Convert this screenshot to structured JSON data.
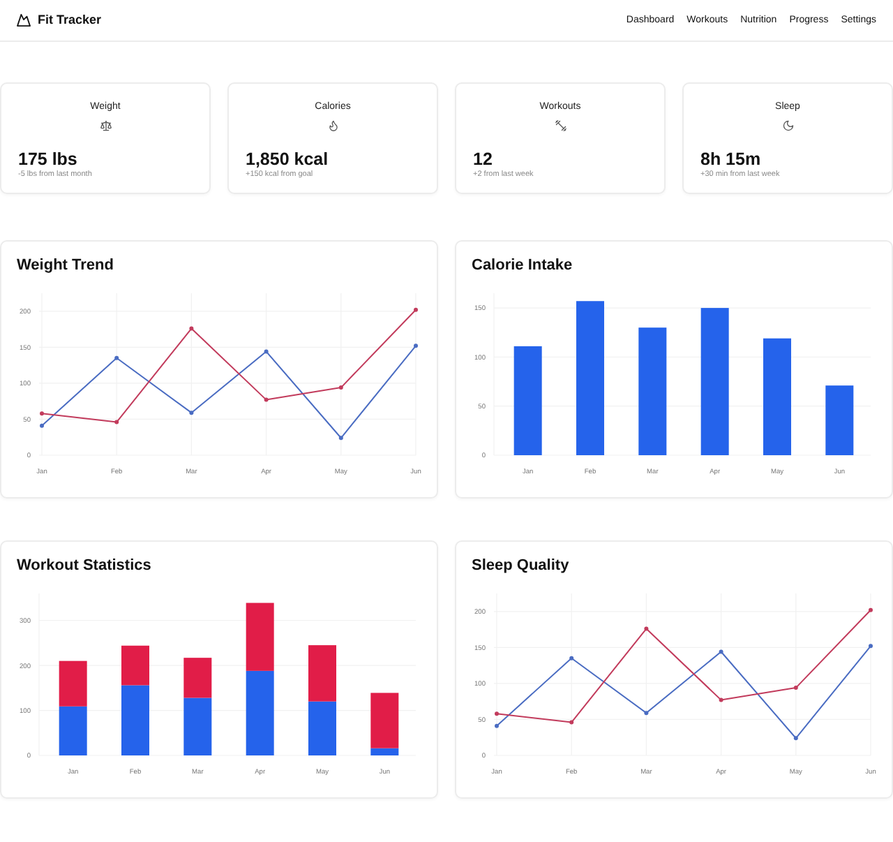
{
  "header": {
    "title": "Fit Tracker",
    "nav": [
      "Dashboard",
      "Workouts",
      "Nutrition",
      "Progress",
      "Settings"
    ]
  },
  "stats": [
    {
      "kind": "weight",
      "label": "Weight",
      "value": "175 lbs",
      "change": "-5 lbs from last month"
    },
    {
      "kind": "calories",
      "label": "Calories",
      "value": "1,850 kcal",
      "change": "+150 kcal from goal"
    },
    {
      "kind": "workouts",
      "label": "Workouts",
      "value": "12",
      "change": "+2 from last week"
    },
    {
      "kind": "sleep",
      "label": "Sleep",
      "value": "8h 15m",
      "change": "+30 min from last week"
    }
  ],
  "charts": [
    {
      "title": "Weight Trend",
      "chart_data": {
        "type": "line",
        "grid": true,
        "categories": [
          "Jan",
          "Feb",
          "Mar",
          "Apr",
          "May",
          "Jun"
        ],
        "series": [
          {
            "color": "#4a6cc2",
            "marker": "circle",
            "values": [
              41,
              135,
              59,
              144,
              24,
              152
            ]
          },
          {
            "color": "#c23b5c",
            "marker": "circle",
            "values": [
              58,
              46,
              176,
              77,
              94,
              202
            ]
          }
        ],
        "ylim": [
          0,
          225
        ],
        "yticks": [
          0,
          50,
          100,
          150,
          200
        ]
      }
    },
    {
      "title": "Calorie Intake",
      "chart_data": {
        "type": "bar",
        "grid": true,
        "categories": [
          "Jan",
          "Feb",
          "Mar",
          "Apr",
          "May",
          "Jun"
        ],
        "series": [
          {
            "color": "#2563eb",
            "values": [
              111,
              157,
              130,
              150,
              119,
              71
            ]
          }
        ],
        "ylim": [
          0,
          165
        ],
        "yticks": [
          0,
          50,
          100,
          150
        ]
      }
    },
    {
      "title": "Workout Statistics",
      "chart_data": {
        "type": "bar",
        "grid": true,
        "stacked": true,
        "categories": [
          "Jan",
          "Feb",
          "Mar",
          "Apr",
          "May",
          "Jun"
        ],
        "series": [
          {
            "color": "#2563eb",
            "values": [
              109,
              156,
              128,
              188,
              120,
              16
            ]
          },
          {
            "color": "#e11d48",
            "values": [
              101,
              88,
              89,
              151,
              125,
              123
            ]
          }
        ],
        "ylim": [
          0,
          360
        ],
        "yticks": [
          0,
          100,
          200,
          300
        ]
      }
    },
    {
      "title": "Sleep Quality",
      "chart_data": {
        "type": "line",
        "grid": true,
        "categories": [
          "Jan",
          "Feb",
          "Mar",
          "Apr",
          "May",
          "Jun"
        ],
        "series": [
          {
            "color": "#4a6cc2",
            "marker": "circle",
            "values": [
              41,
              135,
              59,
              144,
              24,
              152
            ]
          },
          {
            "color": "#c23b5c",
            "marker": "circle",
            "values": [
              58,
              46,
              176,
              77,
              94,
              202
            ]
          }
        ],
        "ylim": [
          0,
          225
        ],
        "yticks": [
          0,
          50,
          100,
          150,
          200
        ]
      }
    }
  ]
}
